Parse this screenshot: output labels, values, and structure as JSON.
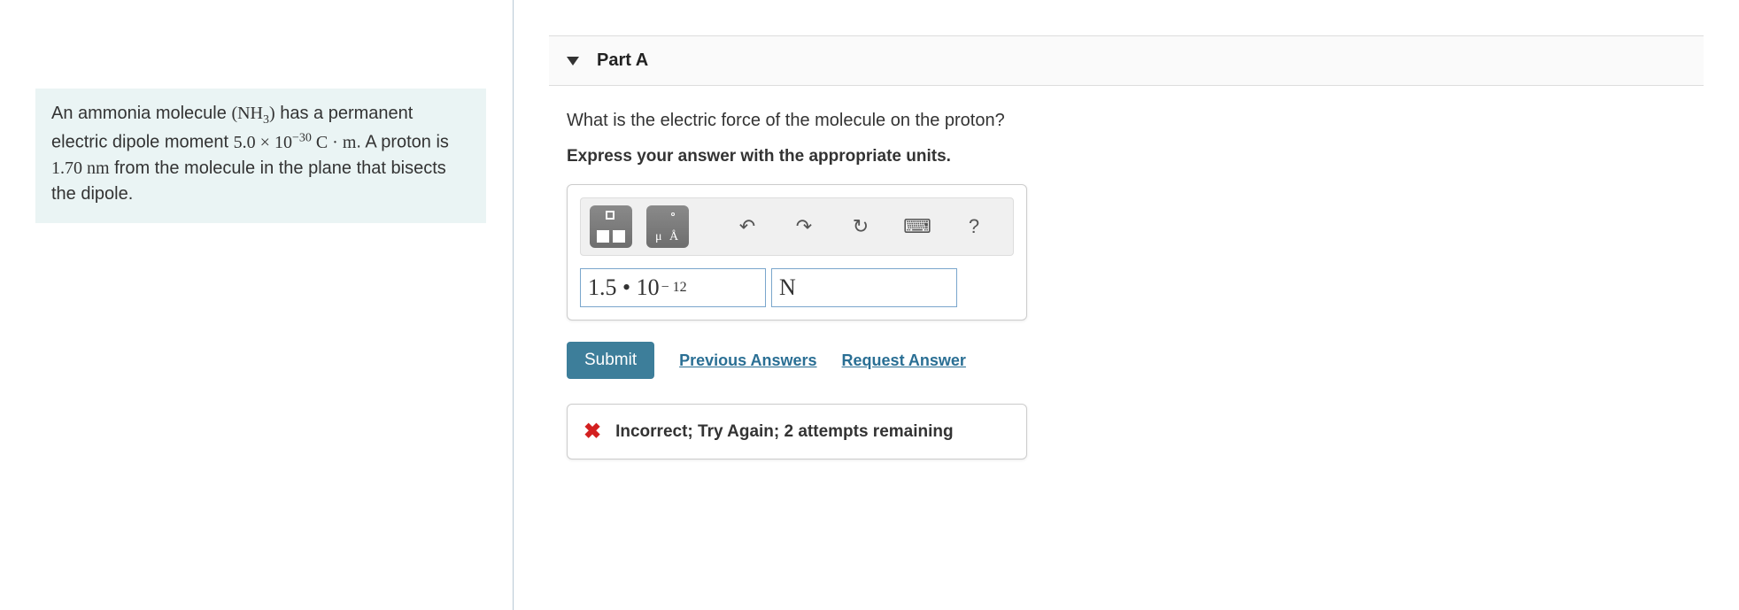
{
  "problem": {
    "text_1": "An ammonia molecule ",
    "formula_nh3_pre": "(NH",
    "formula_nh3_sub": "3",
    "formula_nh3_post": ")",
    "text_2": " has a permanent electric dipole moment ",
    "moment_coeff": "5.0",
    "moment_times": " × ",
    "moment_base": "10",
    "moment_exp": "−30",
    "moment_units": " C · m",
    "text_3": ". A proton is ",
    "distance": "1.70 nm",
    "text_4": " from the molecule in the plane that bisects the dipole."
  },
  "part": {
    "label": "Part A",
    "question": "What is the electric force of the molecule on the proton?",
    "instruction": "Express your answer with the appropriate units."
  },
  "answer": {
    "value_display": "1.5 • 10",
    "value_exp": "− 12",
    "unit": "N"
  },
  "controls": {
    "submit": "Submit",
    "prev": "Previous Answers",
    "request": "Request Answer"
  },
  "feedback": {
    "text": "Incorrect; Try Again; 2 attempts remaining"
  },
  "icons": {
    "undo": "↶",
    "redo": "↷",
    "reset": "↻",
    "keyboard": "⌨",
    "help": "?",
    "x": "✖"
  }
}
